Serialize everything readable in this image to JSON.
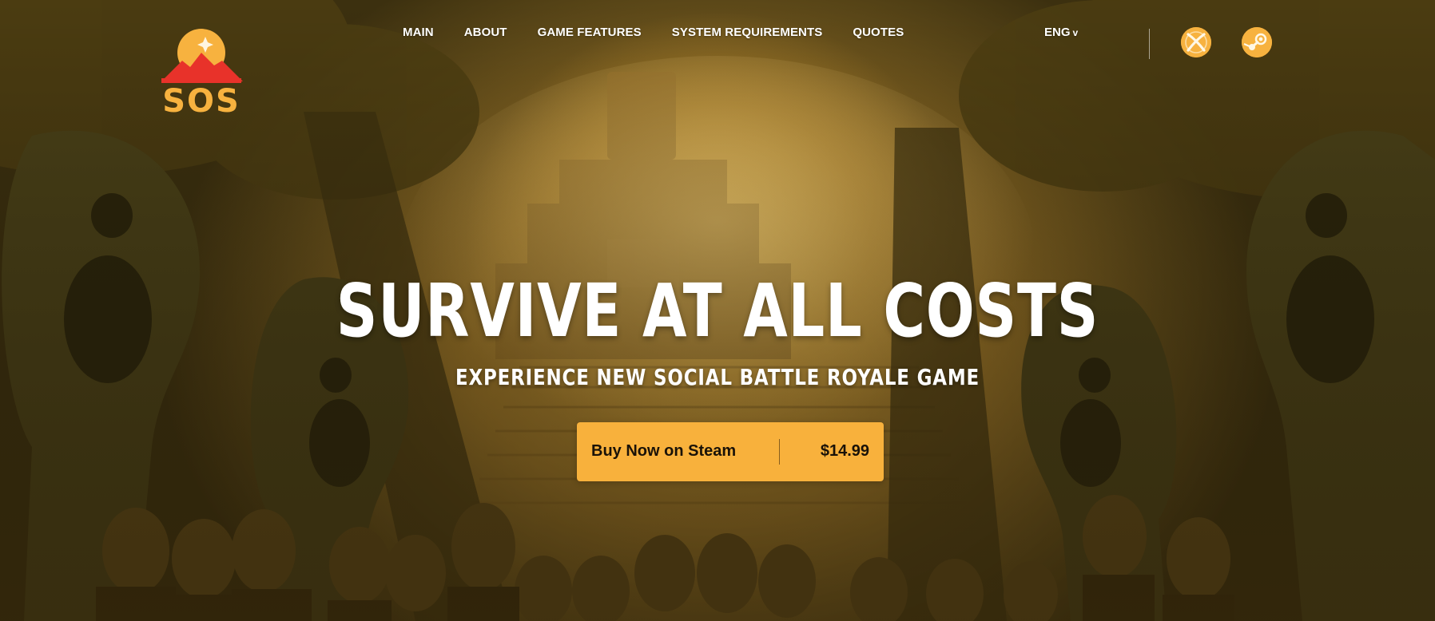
{
  "brand": {
    "logo_text": "SOS"
  },
  "nav": {
    "items": [
      {
        "label": "MAIN"
      },
      {
        "label": "ABOUT"
      },
      {
        "label": "GAME FEATURES"
      },
      {
        "label": "SYSTEM REQUIREMENTS"
      },
      {
        "label": "QUOTES"
      }
    ],
    "language": "ENG",
    "language_chevron": "v"
  },
  "platforms": {
    "xbox_icon": "xbox-icon",
    "steam_icon": "steam-icon"
  },
  "hero": {
    "headline": "SURVIVE AT ALL COSTS",
    "subheadline": "EXPERIENCE NEW SOCIAL BATTLE ROYALE GAME"
  },
  "buy": {
    "label": "Buy Now on Steam",
    "price": "$14.99"
  },
  "colors": {
    "accent": "#f8b13c",
    "logo_red": "#e8322a",
    "text": "#ffffff"
  }
}
